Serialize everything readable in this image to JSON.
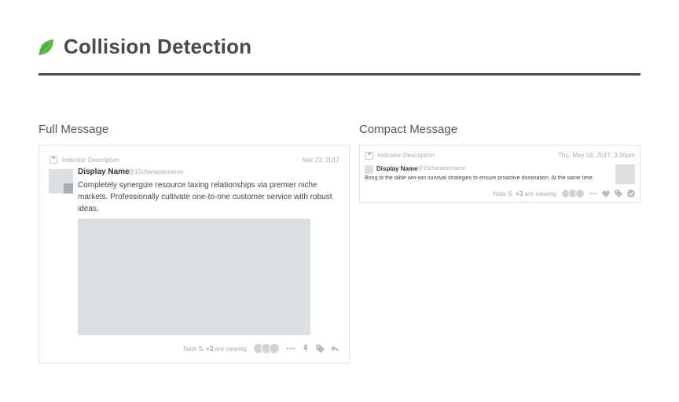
{
  "header": {
    "title": "Collision Detection",
    "brand_color": "#5fbb46"
  },
  "sections": {
    "full_title": "Full Message",
    "compact_title": "Compact Message"
  },
  "full_message": {
    "indicator": "Indicator Description",
    "date": "Mar 23, 2017",
    "display_name": "Display Name",
    "handle": "@15charactername",
    "body": "Completely synergize resource taxing relationships via premier niche markets. Professionally cultivate one-to-one customer service with robust ideas.",
    "viewing_name": "Nate S.",
    "viewing_more": "+3",
    "viewing_suffix": "are viewing",
    "actions": [
      "more-icon",
      "pin-icon",
      "tag-icon",
      "reply-icon"
    ]
  },
  "compact_message": {
    "indicator": "Indicator Description",
    "date": "Thu, May 18, 2017, 3:00pm",
    "display_name": "Display Name",
    "handle": "@15charactername",
    "body": "Bring to the table win-win survival strategies to ensure proactive domination. At the same time",
    "viewing_name": "Nate S.",
    "viewing_more": "+3",
    "viewing_suffix": "are viewing",
    "actions": [
      "more-icon",
      "heart-icon",
      "tag-icon",
      "check-circle-icon"
    ]
  },
  "colors": {
    "icon": "#b7bcbf",
    "placeholder": "#dcdfe1",
    "rule": "#4a4a4a"
  }
}
